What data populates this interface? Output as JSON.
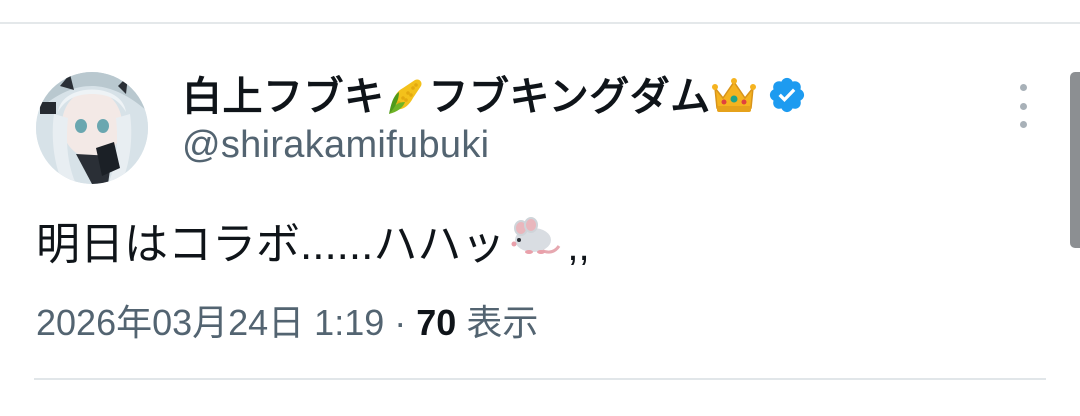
{
  "tweet": {
    "author": {
      "display_name_part1": "白上フブキ",
      "display_name_part2": "フブキングダム",
      "handle": "@shirakamifubuki",
      "emojis": [
        "corn-emoji",
        "crown-emoji"
      ],
      "verified": true
    },
    "text_main": "明日はコラボ......ハハッ",
    "text_tail": ",,",
    "text_emoji": "mouse-emoji",
    "timestamp": "2026年03月24日 1:19",
    "separator": "·",
    "views_count": "70",
    "views_label": "表示"
  },
  "colors": {
    "text": "#0f1419",
    "secondary": "#536471",
    "verified_badge": "#1d9bf0",
    "divider": "#e4e8ea"
  }
}
